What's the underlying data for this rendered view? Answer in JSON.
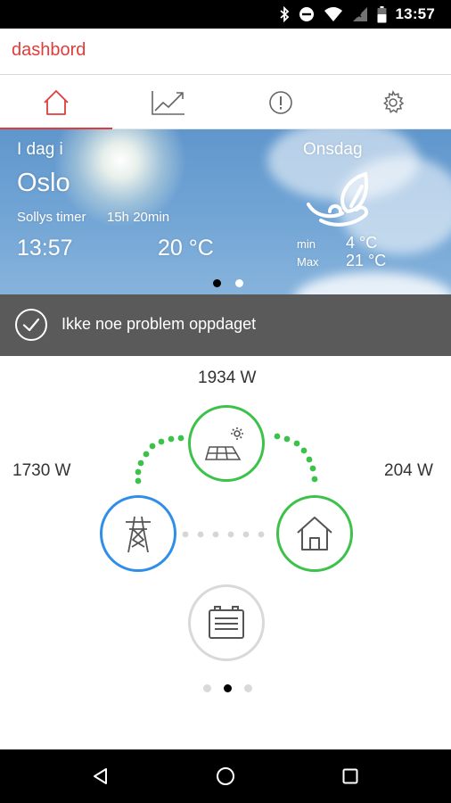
{
  "status_bar": {
    "time": "13:57"
  },
  "header": {
    "title": "dashbord"
  },
  "tabs": [
    {
      "name": "home",
      "icon": "home-icon",
      "active": true
    },
    {
      "name": "statistics",
      "icon": "chart-line-icon",
      "active": false
    },
    {
      "name": "alerts",
      "icon": "alert-circle-icon",
      "active": false
    },
    {
      "name": "settings",
      "icon": "gear-icon",
      "active": false
    }
  ],
  "weather": {
    "today_label": "I dag i",
    "city": "Oslo",
    "sun_hours_label": "Sollys timer",
    "sun_hours_value": "15h 20min",
    "time": "13:57",
    "temperature": "20 °C",
    "day": "Onsdag",
    "min_label": "min",
    "min_temp": "4 °C",
    "max_label": "Max",
    "max_temp": "21 °C",
    "icon": "partly-cloudy-wind-icon",
    "page_indicator": {
      "pages": 2,
      "active": 1
    }
  },
  "alert": {
    "icon": "check-circle-icon",
    "text": "Ikke noe problem oppdaget"
  },
  "energy_flow": {
    "solar": {
      "value": "1934 W",
      "icon": "solar-panel-icon",
      "ring_color": "#3cc24a"
    },
    "grid": {
      "value": "1730 W",
      "icon": "power-pylon-icon",
      "ring_color": "#2f8fe8"
    },
    "house": {
      "value": "204 W",
      "icon": "house-icon",
      "ring_color": "#3cc24a"
    },
    "battery": {
      "icon": "battery-icon",
      "ring_color": "#d9d9d9"
    },
    "page_indicator": {
      "pages": 3,
      "active": 2
    }
  },
  "colors": {
    "accent": "#e03c3c",
    "green": "#3cc24a",
    "blue": "#2f8fe8",
    "alert_bg": "#5a5a5a"
  }
}
